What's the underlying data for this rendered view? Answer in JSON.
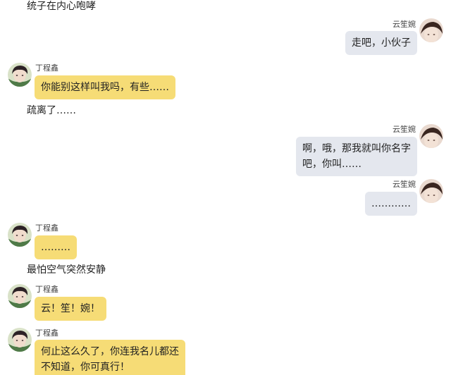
{
  "captions": [
    "统子在内心咆哮",
    "疏离了……",
    "最怕空气突然安静"
  ],
  "participants": {
    "left_name": "丁程鑫",
    "right_name": "云笙婉"
  },
  "messages": [
    {
      "sender": "云笙婉",
      "text": "走吧，小伙子"
    },
    {
      "sender": "丁程鑫",
      "text": "你能别这样叫我吗，有些……"
    },
    {
      "sender": "云笙婉",
      "text": "啊，哦，那我就叫你名字\n吧，你叫……"
    },
    {
      "sender": "云笙婉",
      "text": "…………"
    },
    {
      "sender": "丁程鑫",
      "text": "………"
    },
    {
      "sender": "丁程鑫",
      "text": "云！笙！婉！"
    },
    {
      "sender": "丁程鑫",
      "text": "何止这么久了，你连我名儿都还\n不知道，你可真行！"
    }
  ],
  "colors": {
    "left_bubble": "#f6dc76",
    "right_bubble": "#e4e7ee"
  },
  "icons": {
    "left_avatar": "boy-portrait-avatar",
    "right_avatar": "girl-portrait-avatar"
  }
}
